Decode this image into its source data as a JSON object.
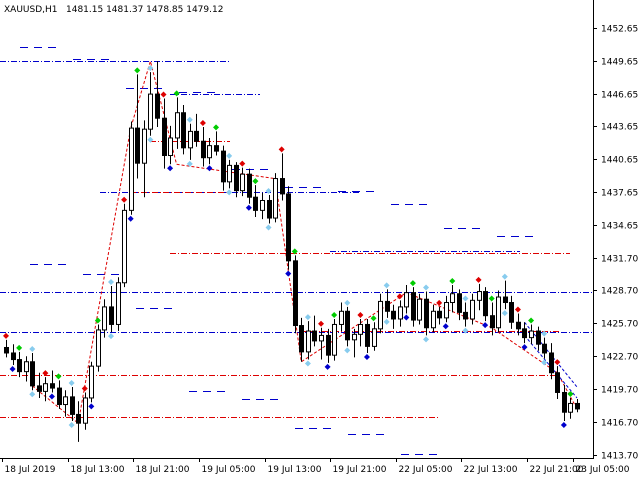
{
  "title": {
    "symbol": "XAUUSD,H1",
    "ohlc": "1481.15 1481.37 1478.85 1479.12"
  },
  "colors": {
    "up_candle": "#ffffff",
    "down_candle": "#000000",
    "wick": "#000000",
    "blue": "#0000cc",
    "red": "#dd0000",
    "lightblue": "#88ccee",
    "salmon": "#ff8888",
    "green": "#00cc00",
    "cyan": "#00cccc"
  },
  "chart_data": {
    "type": "candlestick",
    "symbol": "XAUUSD",
    "timeframe": "H1",
    "ylim": [
      1413.7,
      1453.9
    ],
    "y_ticks": [
      "1452.65",
      "1449.65",
      "1446.65",
      "1443.65",
      "1440.65",
      "1437.65",
      "1434.65",
      "1431.70",
      "1428.70",
      "1425.70",
      "1422.70",
      "1419.70",
      "1416.70",
      "1413.70"
    ],
    "x_ticks": [
      "18 Jul 2019",
      "18 Jul 13:00",
      "18 Jul 21:00",
      "19 Jul 05:00",
      "19 Jul 13:00",
      "19 Jul 21:00",
      "22 Jul 05:00",
      "22 Jul 13:00",
      "22 Jul 21:00",
      "23 Jul 05:00"
    ],
    "candles": [
      [
        1423.5,
        1424.2,
        1422.6,
        1423.0
      ],
      [
        1423.0,
        1423.8,
        1421.9,
        1422.4
      ],
      [
        1422.4,
        1423.1,
        1420.8,
        1421.3
      ],
      [
        1421.3,
        1422.7,
        1420.4,
        1422.2
      ],
      [
        1422.2,
        1423.0,
        1419.6,
        1420.0
      ],
      [
        1420.0,
        1421.2,
        1418.9,
        1419.5
      ],
      [
        1419.5,
        1420.8,
        1418.6,
        1420.2
      ],
      [
        1420.2,
        1421.4,
        1419.4,
        1419.8
      ],
      [
        1419.8,
        1420.5,
        1417.9,
        1418.3
      ],
      [
        1418.3,
        1419.6,
        1417.2,
        1419.0
      ],
      [
        1419.0,
        1419.9,
        1416.8,
        1417.4
      ],
      [
        1417.4,
        1418.6,
        1414.9,
        1416.6
      ],
      [
        1416.6,
        1419.4,
        1416.0,
        1418.9
      ],
      [
        1418.9,
        1422.2,
        1418.5,
        1421.8
      ],
      [
        1421.8,
        1425.6,
        1421.3,
        1425.1
      ],
      [
        1425.1,
        1427.9,
        1424.4,
        1427.2
      ],
      [
        1427.2,
        1429.1,
        1424.9,
        1425.6
      ],
      [
        1425.6,
        1429.9,
        1425.0,
        1429.4
      ],
      [
        1429.4,
        1436.6,
        1429.0,
        1436.0
      ],
      [
        1436.0,
        1444.1,
        1435.6,
        1443.5
      ],
      [
        1443.5,
        1448.4,
        1438.9,
        1440.3
      ],
      [
        1440.3,
        1444.2,
        1437.2,
        1443.4
      ],
      [
        1443.4,
        1448.6,
        1442.8,
        1446.6
      ],
      [
        1446.6,
        1449.6,
        1443.6,
        1444.4
      ],
      [
        1444.4,
        1446.2,
        1439.8,
        1441.0
      ],
      [
        1441.0,
        1443.7,
        1440.2,
        1442.6
      ],
      [
        1442.6,
        1446.3,
        1441.6,
        1444.9
      ],
      [
        1444.9,
        1445.6,
        1441.1,
        1441.7
      ],
      [
        1441.7,
        1443.9,
        1440.6,
        1443.2
      ],
      [
        1443.2,
        1444.8,
        1441.8,
        1442.3
      ],
      [
        1442.3,
        1443.6,
        1440.0,
        1440.8
      ],
      [
        1440.8,
        1442.6,
        1440.2,
        1441.9
      ],
      [
        1441.9,
        1443.2,
        1441.0,
        1441.4
      ],
      [
        1441.4,
        1441.9,
        1437.8,
        1438.6
      ],
      [
        1438.6,
        1440.6,
        1438.0,
        1440.1
      ],
      [
        1440.1,
        1440.4,
        1437.2,
        1437.8
      ],
      [
        1437.8,
        1439.9,
        1437.3,
        1439.3
      ],
      [
        1439.3,
        1439.8,
        1436.6,
        1437.2
      ],
      [
        1437.2,
        1438.3,
        1435.4,
        1436.0
      ],
      [
        1436.0,
        1437.6,
        1435.2,
        1436.9
      ],
      [
        1436.9,
        1437.4,
        1434.8,
        1435.3
      ],
      [
        1435.3,
        1439.4,
        1434.9,
        1438.9
      ],
      [
        1438.9,
        1441.2,
        1436.9,
        1437.5
      ],
      [
        1437.5,
        1438.2,
        1430.6,
        1431.4
      ],
      [
        1431.4,
        1431.9,
        1424.8,
        1425.5
      ],
      [
        1425.5,
        1426.2,
        1422.2,
        1423.1
      ],
      [
        1423.1,
        1425.9,
        1422.4,
        1425.0
      ],
      [
        1425.0,
        1426.4,
        1423.6,
        1424.1
      ],
      [
        1424.1,
        1425.3,
        1422.4,
        1424.6
      ],
      [
        1424.6,
        1425.2,
        1422.1,
        1422.8
      ],
      [
        1422.8,
        1426.1,
        1422.3,
        1425.6
      ],
      [
        1425.6,
        1427.6,
        1425.0,
        1426.8
      ],
      [
        1426.8,
        1427.2,
        1423.6,
        1424.2
      ],
      [
        1424.2,
        1425.2,
        1422.6,
        1424.7
      ],
      [
        1424.7,
        1426.1,
        1423.6,
        1425.6
      ],
      [
        1425.6,
        1426.1,
        1423.0,
        1423.6
      ],
      [
        1423.6,
        1425.8,
        1423.2,
        1425.2
      ],
      [
        1425.2,
        1428.4,
        1424.8,
        1427.7
      ],
      [
        1427.7,
        1428.8,
        1426.2,
        1426.8
      ],
      [
        1426.8,
        1427.4,
        1425.2,
        1426.1
      ],
      [
        1426.1,
        1427.8,
        1425.4,
        1427.2
      ],
      [
        1427.2,
        1429.2,
        1426.6,
        1428.5
      ],
      [
        1428.5,
        1429.0,
        1425.4,
        1426.0
      ],
      [
        1426.0,
        1428.4,
        1425.6,
        1427.9
      ],
      [
        1427.9,
        1428.6,
        1424.6,
        1425.3
      ],
      [
        1425.3,
        1427.4,
        1424.9,
        1426.8
      ],
      [
        1426.8,
        1427.2,
        1425.6,
        1426.2
      ],
      [
        1426.2,
        1428.2,
        1425.8,
        1427.6
      ],
      [
        1427.6,
        1429.2,
        1426.7,
        1428.4
      ],
      [
        1428.4,
        1428.8,
        1426.0,
        1426.7
      ],
      [
        1426.7,
        1427.6,
        1425.4,
        1426.1
      ],
      [
        1426.1,
        1428.4,
        1425.6,
        1427.8
      ],
      [
        1427.8,
        1429.3,
        1426.9,
        1428.6
      ],
      [
        1428.6,
        1429.0,
        1425.9,
        1426.4
      ],
      [
        1426.4,
        1427.6,
        1424.6,
        1425.3
      ],
      [
        1425.3,
        1428.7,
        1424.9,
        1428.1
      ],
      [
        1428.1,
        1429.6,
        1427.0,
        1427.6
      ],
      [
        1427.6,
        1428.2,
        1425.2,
        1425.8
      ],
      [
        1425.8,
        1426.6,
        1424.6,
        1425.2
      ],
      [
        1425.2,
        1425.8,
        1423.9,
        1424.4
      ],
      [
        1424.4,
        1425.6,
        1423.8,
        1425.0
      ],
      [
        1425.0,
        1425.4,
        1423.2,
        1423.8
      ],
      [
        1423.8,
        1424.4,
        1422.5,
        1423.0
      ],
      [
        1423.0,
        1423.9,
        1420.6,
        1421.2
      ],
      [
        1421.2,
        1421.8,
        1418.8,
        1419.4
      ],
      [
        1419.4,
        1420.1,
        1416.8,
        1417.6
      ],
      [
        1417.6,
        1418.9,
        1417.0,
        1418.4
      ],
      [
        1418.4,
        1418.8,
        1417.6,
        1417.9
      ]
    ]
  },
  "overlays": {
    "blue_dashdot_levels": [
      1449.6,
      1446.6,
      1437.7,
      1432.3,
      1428.6,
      1424.9
    ],
    "red_dashdot_levels": [
      1442.3,
      1437.7,
      1432.1,
      1425.0,
      1421.0,
      1417.2
    ],
    "short_dash_levels": [
      1450.9,
      1449.8,
      1447.2,
      1446.8,
      1439.8,
      1438.1,
      1437.8,
      1436.6,
      1434.4,
      1433.7,
      1431.1,
      1430.2,
      1427.1,
      1419.5,
      1418.8,
      1416.2,
      1415.6,
      1413.8
    ]
  }
}
